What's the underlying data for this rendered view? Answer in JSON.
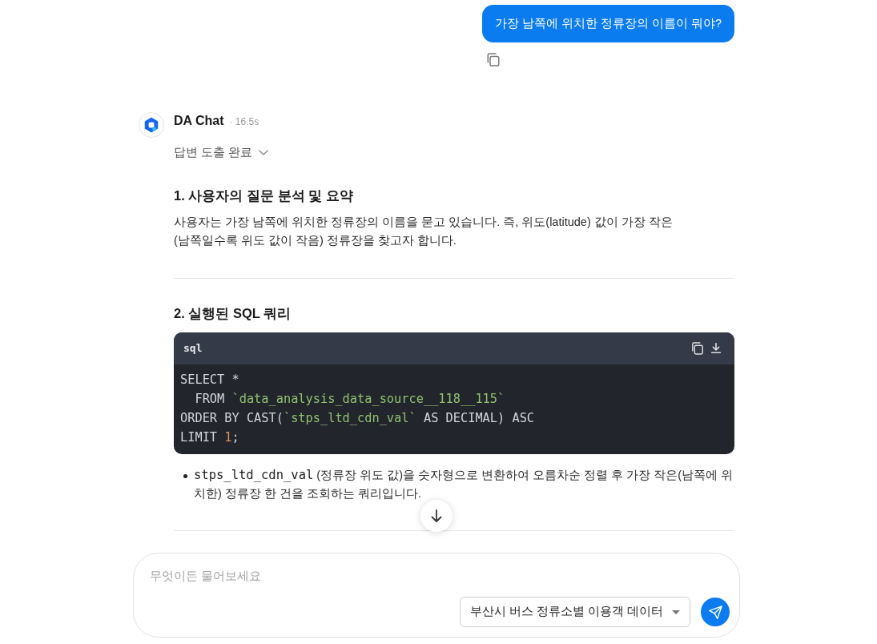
{
  "user_message": {
    "text": "가장 남쪽에 위치한 정류장의 이름이 뭐야?"
  },
  "assistant": {
    "name": "DA Chat",
    "elapsed": "· 16.5s",
    "reasoning": {
      "label": "답변 도출 완료",
      "expanded": false
    },
    "sections": [
      {
        "kind": "text",
        "heading": "1. 사용자의 질문 분석 및 요약",
        "paragraph": "사용자는 가장 남쪽에 위치한 정류장의 이름을 묻고 있습니다. 즉, 위도(latitude) 값이 가장 작은(남쪽일수록 위도 값이 작음) 정류장을 찾고자 합니다."
      },
      {
        "kind": "code",
        "heading": "2. 실행된 SQL 쿼리",
        "language": "sql",
        "code_lines": [
          [
            {
              "kind": "plain",
              "text": "SELECT *"
            }
          ],
          [
            {
              "kind": "plain",
              "text": "  FROM "
            },
            {
              "kind": "string",
              "text": "`data_analysis_data_source__118__115`"
            }
          ],
          [
            {
              "kind": "plain",
              "text": "ORDER BY CAST("
            },
            {
              "kind": "string",
              "text": "`stps_ltd_cdn_val`"
            },
            {
              "kind": "plain",
              "text": " AS DECIMAL) ASC"
            }
          ],
          [
            {
              "kind": "plain",
              "text": "LIMIT "
            },
            {
              "kind": "number",
              "text": "1"
            },
            {
              "kind": "plain",
              "text": ";"
            }
          ]
        ],
        "bullets": [
          {
            "code": "stps_ltd_cdn_val",
            "text": "(정류장 위도 값)을 숫자형으로 변환하여 오름차순 정렬 후 가장 작은(남쪽에 위치한) 정류장 한 건을 조회하는 쿼리입니다."
          }
        ]
      }
    ]
  },
  "composer": {
    "placeholder": "무엇이든 물어보세요",
    "data_source": "부산시 버스 정류소별 이용객 데이터"
  }
}
